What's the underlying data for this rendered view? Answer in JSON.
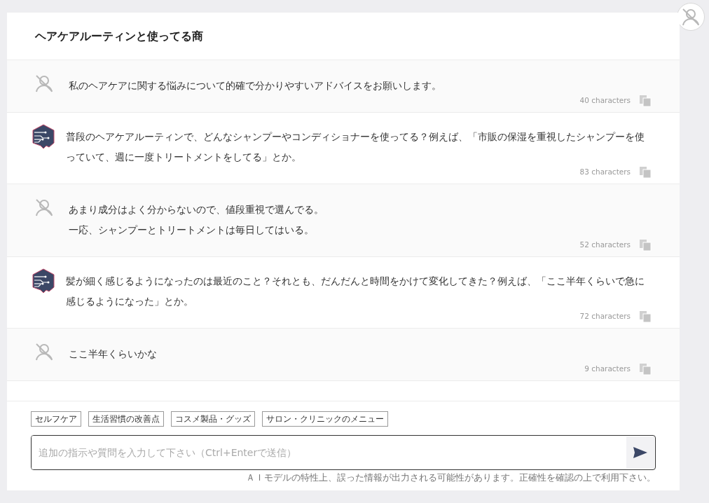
{
  "header": {
    "title": "ヘアケアルーティンと使ってる商"
  },
  "messages": [
    {
      "kind": "user",
      "lines": [
        "私のヘアケアに関する悩みについて的確で分かりやすいアドバイスをお願いします。"
      ],
      "count": "40 characters"
    },
    {
      "kind": "ai",
      "lines": [
        "普段のヘアケアルーティンで、どんなシャンプーやコンディショナーを使ってる？例えば、「市販の保湿を重視したシャンプーを使っていて、週に一度トリートメントをしてる」とか。"
      ],
      "count": "83 characters"
    },
    {
      "kind": "user",
      "lines": [
        "あまり成分はよく分からないので、値段重視で選んでる。",
        "一応、シャンプーとトリートメントは毎日してはいる。"
      ],
      "count": "52 characters"
    },
    {
      "kind": "ai",
      "lines": [
        "髪が細く感じるようになったのは最近のこと？それとも、だんだんと時間をかけて変化してきた？例えば、「ここ半年くらいで急に感じるようになった」とか。"
      ],
      "count": "72 characters"
    },
    {
      "kind": "user",
      "lines": [
        "ここ半年くらいかな"
      ],
      "count": "9 characters"
    }
  ],
  "suggestions": [
    "セルフケア",
    "生活習慣の改善点",
    "コスメ製品・グッズ",
    "サロン・クリニックのメニュー"
  ],
  "input": {
    "placeholder": "追加の指示や質問を入力して下さい（Ctrl+Enterで送信）"
  },
  "disclaimer": "ＡＩモデルの特性上、誤った情報が出力される可能性があります。正確性を確認の上で利用下さい。"
}
